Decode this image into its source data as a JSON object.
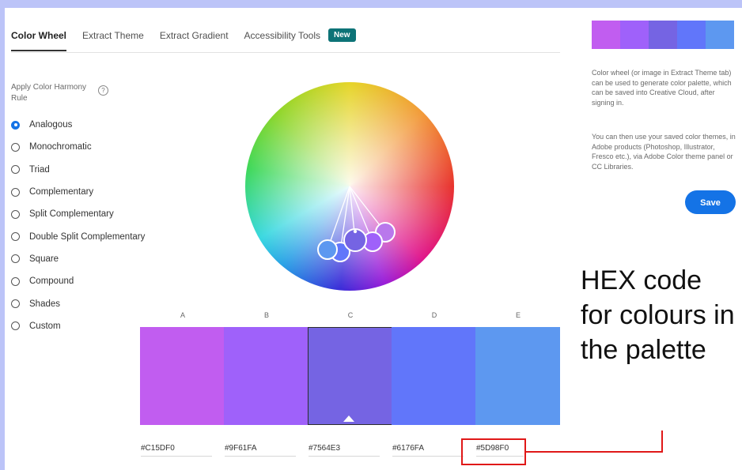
{
  "tabs": [
    {
      "label": "Color Wheel",
      "active": true
    },
    {
      "label": "Extract Theme",
      "active": false
    },
    {
      "label": "Extract Gradient",
      "active": false
    },
    {
      "label": "Accessibility Tools",
      "active": false
    }
  ],
  "badge": "New",
  "harmony": {
    "label": "Apply Color Harmony Rule",
    "help_icon": "question-icon",
    "selected": "Analogous",
    "rules": [
      "Analogous",
      "Monochromatic",
      "Triad",
      "Complementary",
      "Split Complementary",
      "Double Split Complementary",
      "Square",
      "Compound",
      "Shades",
      "Custom"
    ]
  },
  "palette": {
    "columns": [
      "A",
      "B",
      "C",
      "D",
      "E"
    ],
    "hex": [
      "#C15DF0",
      "#9F61FA",
      "#7564E3",
      "#6176FA",
      "#5D98F0"
    ],
    "colors": [
      "#c15df0",
      "#9f61fa",
      "#7564e3",
      "#6176fa",
      "#5d98f0"
    ],
    "selected_index": 2
  },
  "sidebar": {
    "desc1": "Color wheel (or image in Extract Theme tab) can be used to generate color palette, which can be saved into Creative Cloud, after signing in.",
    "desc2": "You can then use your saved color themes, in Adobe products (Photoshop, Illustrator, Fresco etc.), via Adobe Color theme panel or CC Libraries.",
    "save_label": "Save"
  },
  "annotation": "HEX code for colours in the palette",
  "colors": {
    "accent": "#1473e6",
    "badge": "#0d7377",
    "highlight": "#e01818",
    "background": "#bcc4f8"
  }
}
